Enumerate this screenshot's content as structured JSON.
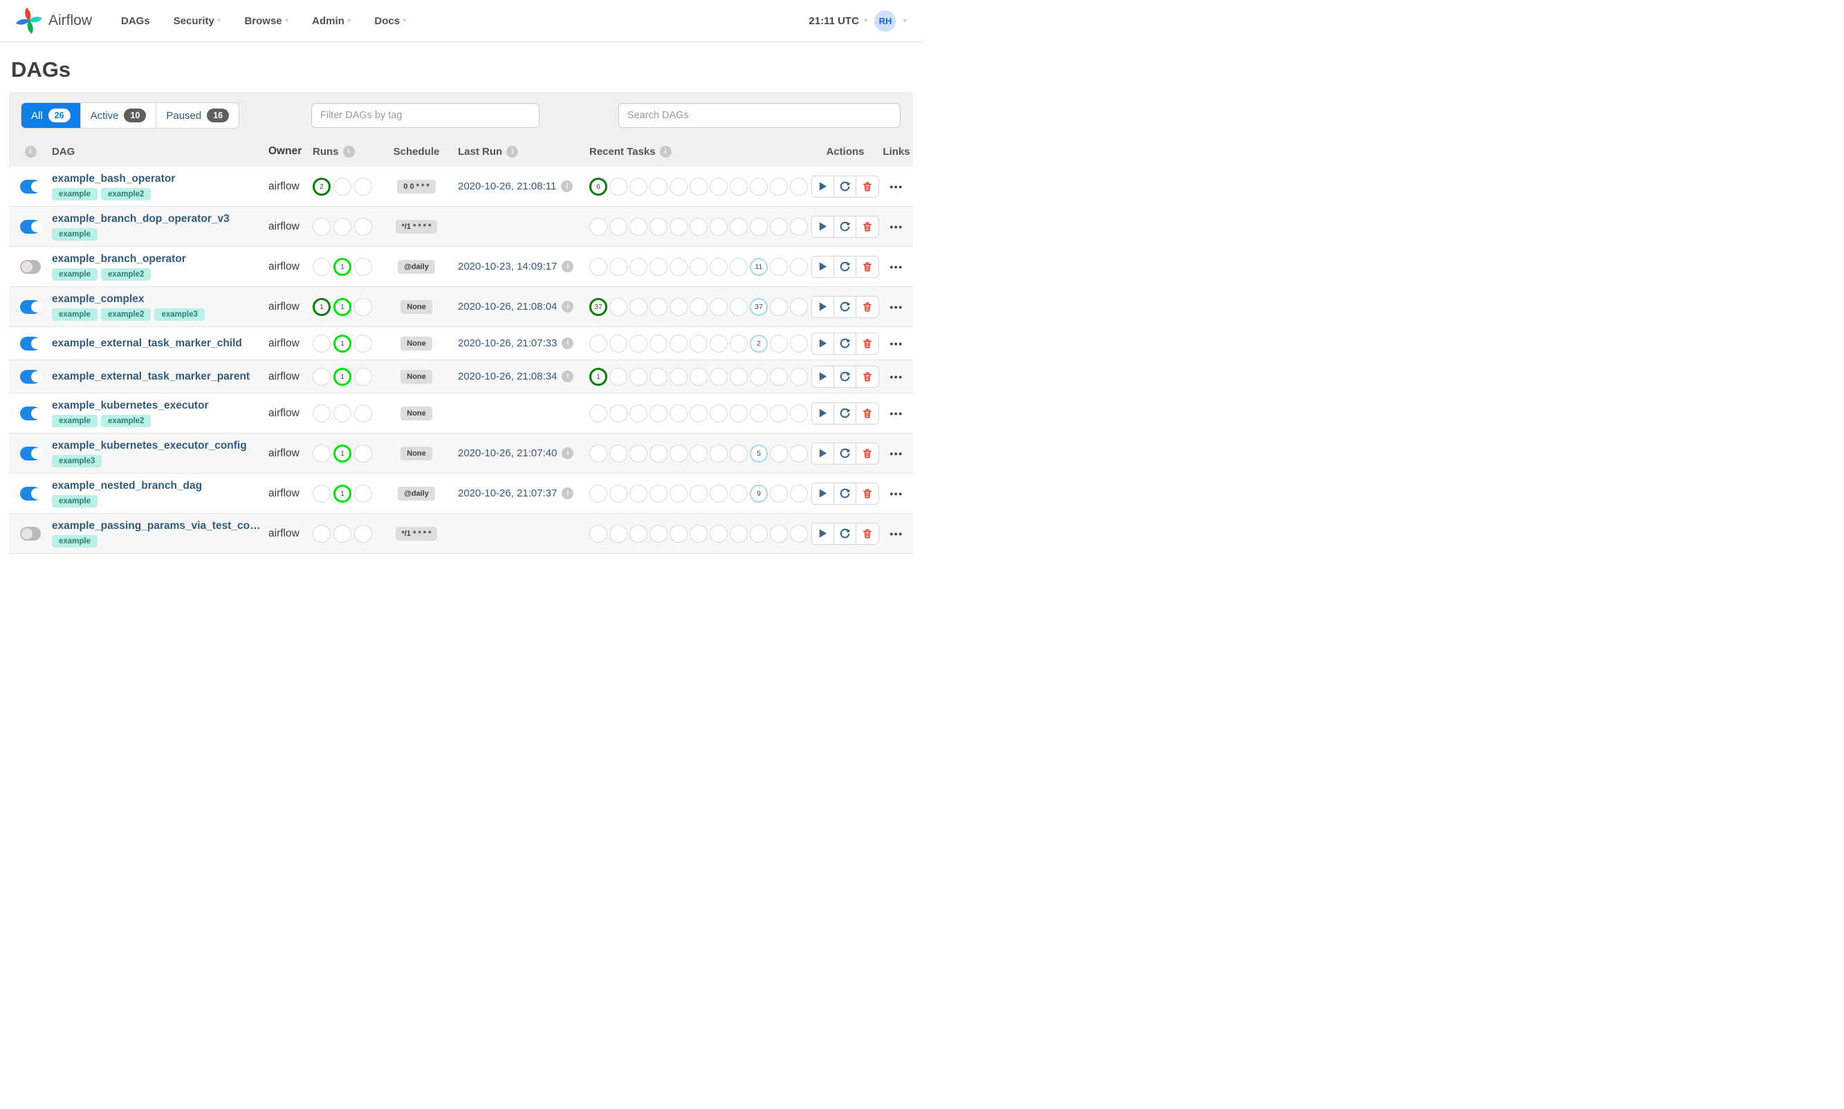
{
  "nav": {
    "brand": "Airflow",
    "items": [
      {
        "label": "DAGs",
        "dropdown": false
      },
      {
        "label": "Security",
        "dropdown": true
      },
      {
        "label": "Browse",
        "dropdown": true
      },
      {
        "label": "Admin",
        "dropdown": true
      },
      {
        "label": "Docs",
        "dropdown": true
      }
    ],
    "clock": "21:11 UTC",
    "avatar_initials": "RH"
  },
  "page": {
    "title": "DAGs"
  },
  "tabs": [
    {
      "label": "All",
      "count": "26",
      "active": true
    },
    {
      "label": "Active",
      "count": "10",
      "active": false
    },
    {
      "label": "Paused",
      "count": "16",
      "active": false
    }
  ],
  "filters": {
    "tag_placeholder": "Filter DAGs by tag",
    "search_placeholder": "Search DAGs"
  },
  "table": {
    "columns": [
      "DAG",
      "Owner",
      "Runs",
      "Schedule",
      "Last Run",
      "Recent Tasks",
      "Actions",
      "Links"
    ],
    "run_states": [
      "success",
      "running",
      "failed"
    ],
    "recent_task_states": [
      "success",
      "running",
      "failed",
      "upstream_failed",
      "skipped",
      "up_for_retry",
      "up_for_reschedule",
      "queued",
      "none",
      "scheduled",
      "sensing"
    ],
    "rows": [
      {
        "name": "example_bash_operator",
        "tags": [
          "example",
          "example2"
        ],
        "enabled": true,
        "owner": "airflow",
        "runs": {
          "success": "2"
        },
        "schedule": "0 0 * * *",
        "last_run": "2020-10-26, 21:08:11",
        "recent_tasks": {
          "success": "6"
        }
      },
      {
        "name": "example_branch_dop_operator_v3",
        "tags": [
          "example"
        ],
        "enabled": true,
        "owner": "airflow",
        "runs": {},
        "schedule": "*/1 * * * *",
        "last_run": "",
        "recent_tasks": {}
      },
      {
        "name": "example_branch_operator",
        "tags": [
          "example",
          "example2"
        ],
        "enabled": false,
        "owner": "airflow",
        "runs": {
          "running": "1"
        },
        "schedule": "@daily",
        "last_run": "2020-10-23, 14:09:17",
        "recent_tasks": {
          "none": "11"
        }
      },
      {
        "name": "example_complex",
        "tags": [
          "example",
          "example2",
          "example3"
        ],
        "enabled": true,
        "owner": "airflow",
        "runs": {
          "success": "1",
          "running": "1"
        },
        "schedule": "None",
        "last_run": "2020-10-26, 21:08:04",
        "recent_tasks": {
          "success": "37",
          "none": "37"
        }
      },
      {
        "name": "example_external_task_marker_child",
        "tags": [],
        "enabled": true,
        "owner": "airflow",
        "runs": {
          "running": "1"
        },
        "schedule": "None",
        "last_run": "2020-10-26, 21:07:33",
        "recent_tasks": {
          "none": "2"
        }
      },
      {
        "name": "example_external_task_marker_parent",
        "tags": [],
        "enabled": true,
        "owner": "airflow",
        "runs": {
          "running": "1"
        },
        "schedule": "None",
        "last_run": "2020-10-26, 21:08:34",
        "recent_tasks": {
          "success": "1"
        }
      },
      {
        "name": "example_kubernetes_executor",
        "tags": [
          "example",
          "example2"
        ],
        "enabled": true,
        "owner": "airflow",
        "runs": {},
        "schedule": "None",
        "last_run": "",
        "recent_tasks": {}
      },
      {
        "name": "example_kubernetes_executor_config",
        "tags": [
          "example3"
        ],
        "enabled": true,
        "owner": "airflow",
        "runs": {
          "running": "1"
        },
        "schedule": "None",
        "last_run": "2020-10-26, 21:07:40",
        "recent_tasks": {
          "none": "5"
        }
      },
      {
        "name": "example_nested_branch_dag",
        "tags": [
          "example"
        ],
        "enabled": true,
        "owner": "airflow",
        "runs": {
          "running": "1"
        },
        "schedule": "@daily",
        "last_run": "2020-10-26, 21:07:37",
        "recent_tasks": {
          "none": "9"
        }
      },
      {
        "name": "example_passing_params_via_test_command",
        "tags": [
          "example"
        ],
        "enabled": false,
        "owner": "airflow",
        "runs": {},
        "schedule": "*/1 * * * *",
        "last_run": "",
        "recent_tasks": {}
      }
    ]
  },
  "icons": {
    "info": "i",
    "caret": "▾",
    "links_dots": "•••"
  },
  "colors": {
    "accent_blue": "#0d7ee8",
    "success": "#077c07",
    "running": "#04e204",
    "state_none": "#a5d8ea",
    "tag_bg": "#b9f1e8",
    "tag_text": "#2f7e72",
    "link_navy": "#315a7d",
    "icon_steel": "#38678f",
    "danger": "#e23b27",
    "toggle_on": "#1d87e8"
  }
}
